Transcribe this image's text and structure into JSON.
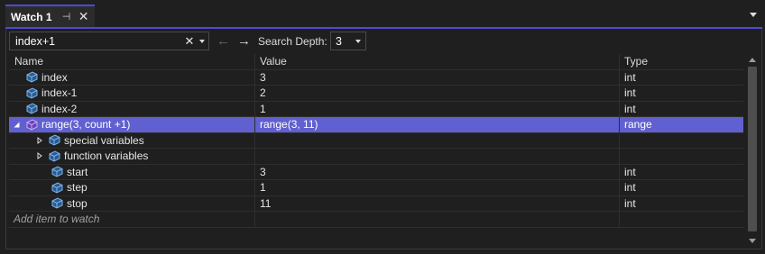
{
  "tab": {
    "title": "Watch 1",
    "pin_glyph": "⊣",
    "close_glyph": "✕"
  },
  "toolbar": {
    "search_value": "index+1",
    "clear_glyph": "✕",
    "back_glyph": "←",
    "forward_glyph": "→",
    "depth_label": "Search Depth:",
    "depth_value": "3"
  },
  "grid": {
    "columns": {
      "name": "Name",
      "value": "Value",
      "type": "Type"
    },
    "rows": [
      {
        "name": "index",
        "value": "3",
        "type": "int"
      },
      {
        "name": "index-1",
        "value": "2",
        "type": "int"
      },
      {
        "name": "index-2",
        "value": "1",
        "type": "int"
      },
      {
        "name": "range(3, count +1)",
        "value": "range(3, 11)",
        "type": "range",
        "expanded": true,
        "selected": true
      },
      {
        "name": "special variables",
        "value": "",
        "type": "",
        "collapsed": true
      },
      {
        "name": "function variables",
        "value": "",
        "type": "",
        "collapsed": true
      },
      {
        "name": "start",
        "value": "3",
        "type": "int"
      },
      {
        "name": "step",
        "value": "1",
        "type": "int"
      },
      {
        "name": "stop",
        "value": "11",
        "type": "int"
      }
    ],
    "add_item_text": "Add item to watch"
  },
  "icons": {
    "variable": "cube-icon",
    "expanded": "triangle-down-icon",
    "collapsed": "triangle-right-icon"
  },
  "colors": {
    "accent": "#4b4bd8",
    "selection": "#6060d0",
    "background": "#1f1f1f"
  }
}
